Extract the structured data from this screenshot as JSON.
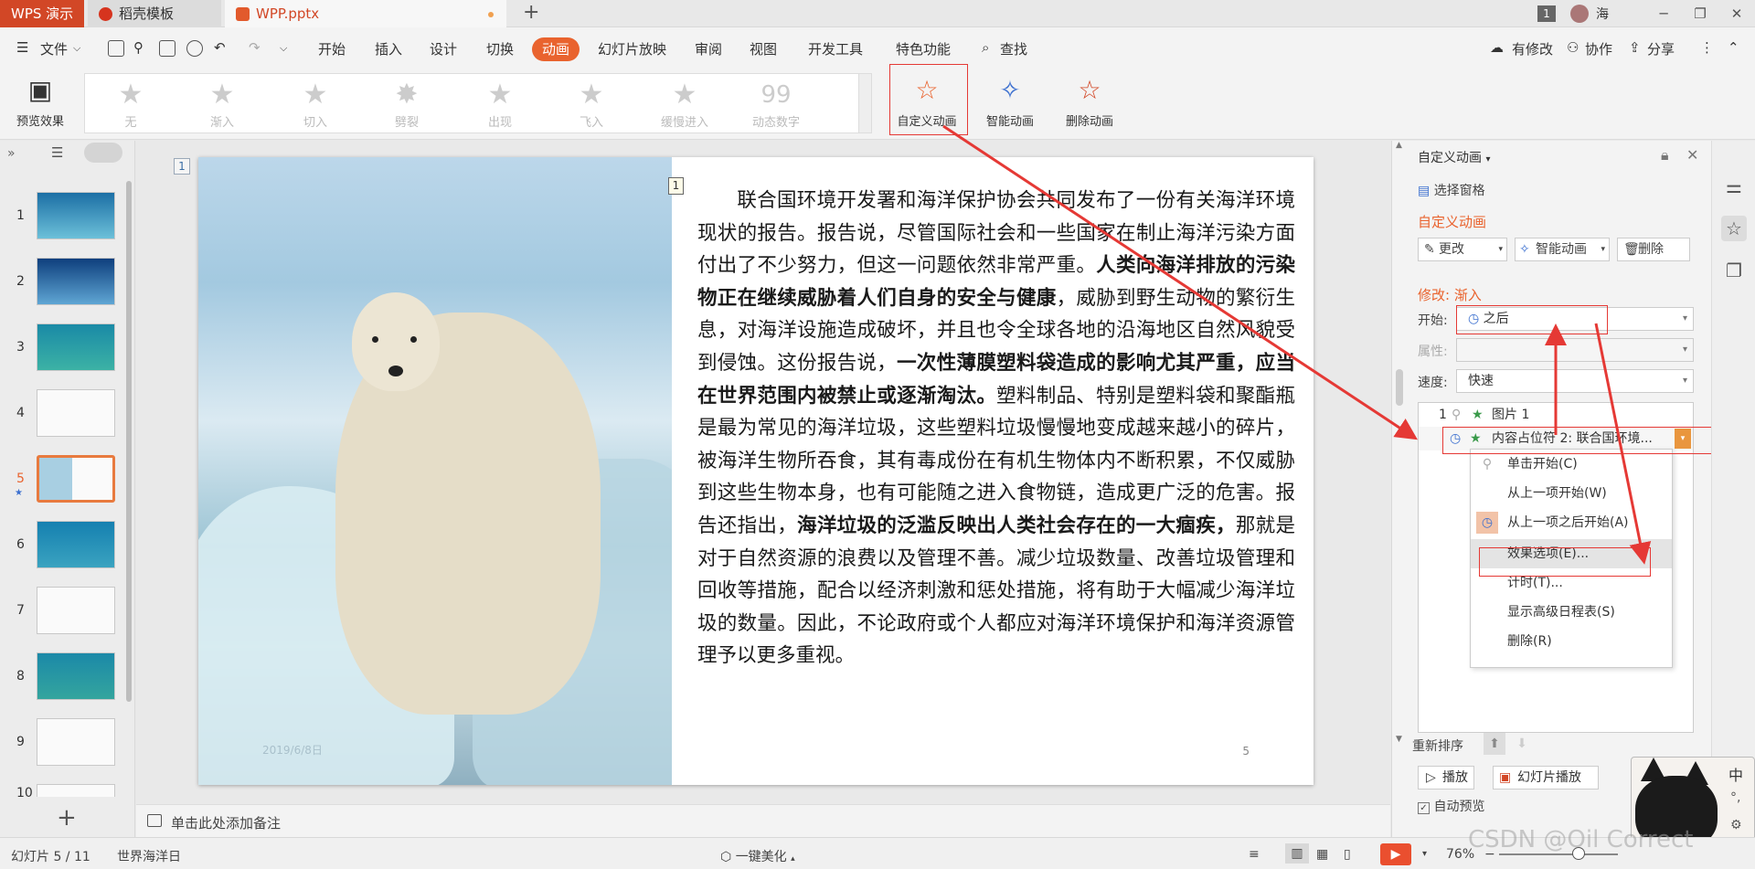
{
  "titlebar": {
    "app_name": "WPS 演示",
    "tabs": [
      {
        "label": "稻壳模板"
      },
      {
        "label": "WPP.pptx"
      }
    ],
    "new_tab": "+",
    "notification_count": "1",
    "user_name": "海"
  },
  "menubar": {
    "file_label": "文件",
    "items": [
      "开始",
      "插入",
      "设计",
      "切换",
      "动画",
      "幻灯片放映",
      "审阅",
      "视图",
      "开发工具",
      "特色功能"
    ],
    "active_item": "动画",
    "search_label": "查找",
    "right_items": [
      "有修改",
      "协作",
      "分享"
    ]
  },
  "ribbon": {
    "preview_label": "预览效果",
    "gallery": [
      "无",
      "渐入",
      "切入",
      "劈裂",
      "出现",
      "飞入",
      "缓慢进入",
      "动态数字"
    ],
    "custom_anim_label": "自定义动画",
    "smart_anim_label": "智能动画",
    "delete_anim_label": "删除动画"
  },
  "thumbnails": {
    "numbers": [
      "1",
      "2",
      "3",
      "4",
      "5",
      "6",
      "7",
      "8",
      "9",
      "10"
    ],
    "selected": "5",
    "add_label": "+"
  },
  "slide": {
    "index_tag": "1",
    "anim_tag": "1",
    "page_number": "5",
    "photo_date": "2019/6/8日",
    "paragraph": [
      {
        "text": "联合国环境开发署和海洋保护协会共同发布了一份有关海洋环境现状的报告。报告说，尽管国际社会和一些国家在制止海洋污染方面付出了不少努力，但这一问题依然非常严重。",
        "bold": false
      },
      {
        "text": "人类向海洋排放的污染物正在继续威胁着人们自身的安全与健康",
        "bold": true
      },
      {
        "text": "，威胁到野生动物的繁衍生息，对海洋设施造成破坏，并且也令全球各地的沿海地区自然风貌受到侵蚀。这份报告说，",
        "bold": false
      },
      {
        "text": "一次性薄膜塑料袋造成的影响尤其严重，应当在世界范围内被禁止或逐渐淘汰。",
        "bold": true
      },
      {
        "text": "塑料制品、特别是塑料袋和聚酯瓶是最为常见的海洋垃圾，这些塑料垃圾慢慢地变成越来越小的碎片，被海洋生物所吞食，其有毒成份在有机生物体内不断积累，不仅威胁到这些生物本身，也有可能随之进入食物链，造成更广泛的危害。报告还指出，",
        "bold": false
      },
      {
        "text": "海洋垃圾的泛滥反映出人类社会存在的一大痼疾，",
        "bold": true
      },
      {
        "text": "那就是对于自然资源的浪费以及管理不善。减少垃圾数量、改善垃圾管理和回收等措施，配合以经济刺激和惩处措施，将有助于大幅减少海洋垃圾的数量。因此，不论政府或个人都应对海洋环境保护和海洋资源管理予以更多重视。",
        "bold": false
      }
    ]
  },
  "notes": {
    "placeholder": "单击此处添加备注"
  },
  "taskpane": {
    "title": "自定义动画",
    "select_pane": "选择窗格",
    "section_title": "自定义动画",
    "change_btn": "更改",
    "smart_btn": "智能动画",
    "delete_btn": "删除",
    "modify_label": "修改: 渐入",
    "start_label": "开始:",
    "start_value": "之后",
    "property_label": "属性:",
    "speed_label": "速度:",
    "speed_value": "快速",
    "list_items": [
      {
        "num": "1",
        "label": "图片 1"
      },
      {
        "num": "",
        "label": "内容占位符 2: 联合国环境..."
      }
    ],
    "context_menu": [
      "单击开始(C)",
      "从上一项开始(W)",
      "从上一项之后开始(A)",
      "效果选项(E)...",
      "计时(T)...",
      "显示高级日程表(S)",
      "删除(R)"
    ],
    "reorder_label": "重新排序",
    "play_btn": "播放",
    "slideshow_btn": "幻灯片播放",
    "autopreview_label": "自动预览"
  },
  "statusbar": {
    "slide_info": "幻灯片 5 / 11",
    "theme": "世界海洋日",
    "beautify": "一键美化",
    "zoom": "76%"
  },
  "watermark": "CSDN @Oil Correct",
  "ime": {
    "lang": "中"
  },
  "colors": {
    "accent": "#e9632e",
    "annotation": "#e53935",
    "wps_red": "#d24726"
  }
}
